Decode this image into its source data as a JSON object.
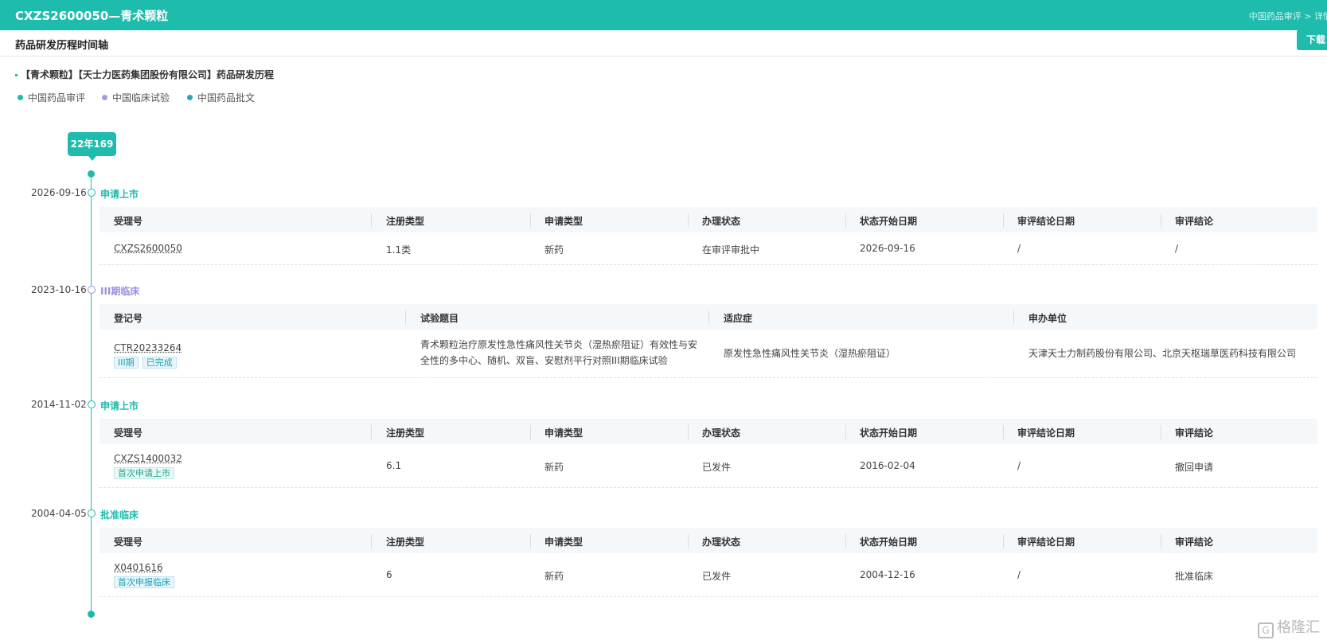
{
  "header": {
    "title": "CXZS2600050—青术颗粒",
    "breadcrumb": "中国药品审评 > 详情"
  },
  "subheader": {
    "title": "药品研发历程时间轴",
    "download_label": "下载"
  },
  "section": {
    "title": "【青术颗粒】【天士力医药集团股份有限公司】药品研发历程"
  },
  "legend": [
    {
      "label": "中国药品审评",
      "color": "#1dbcad"
    },
    {
      "label": "中国临床试验",
      "color": "#a59ae0"
    },
    {
      "label": "中国药品批文",
      "color": "#2aa3c4"
    }
  ],
  "timeline": {
    "duration": "22年169天"
  },
  "colors": {
    "accent": "#1dbcad",
    "clinical": "#9b8ee0"
  },
  "events": [
    {
      "date": "2026-09-16",
      "stage": "申请上市",
      "headers": [
        "受理号",
        "注册类型",
        "申请类型",
        "办理状态",
        "状态开始日期",
        "审评结论日期",
        "审评结论"
      ],
      "row": {
        "id": "CXZS2600050",
        "tags": [],
        "reg_type": "1.1类",
        "app_type": "新药",
        "status": "在审评审批中",
        "status_date": "2026-09-16",
        "conclusion_date": "/",
        "conclusion": "/"
      }
    },
    {
      "date": "2023-10-16",
      "stage": "III期临床",
      "headers": [
        "登记号",
        "试验题目",
        "适应症",
        "申办单位"
      ],
      "row": {
        "id": "CTR20233264",
        "tags": [
          "III期",
          "已完成"
        ],
        "title": "青术颗粒治疗原发性急性痛风性关节炎（湿热瘀阻证）有效性与安全性的多中心、随机、双盲、安慰剂平行对照III期临床试验",
        "indication": "原发性急性痛风性关节炎（湿热瘀阻证）",
        "sponsor": "天津天士力制药股份有限公司、北京天枢瑞草医药科技有限公司"
      }
    },
    {
      "date": "2014-11-02",
      "stage": "申请上市",
      "headers": [
        "受理号",
        "注册类型",
        "申请类型",
        "办理状态",
        "状态开始日期",
        "审评结论日期",
        "审评结论"
      ],
      "row": {
        "id": "CXZS1400032",
        "tags": [
          "首次申请上市"
        ],
        "reg_type": "6.1",
        "app_type": "新药",
        "status": "已发件",
        "status_date": "2016-02-04",
        "conclusion_date": "/",
        "conclusion": "撤回申请"
      }
    },
    {
      "date": "2004-04-05",
      "stage": "批准临床",
      "headers": [
        "受理号",
        "注册类型",
        "申请类型",
        "办理状态",
        "状态开始日期",
        "审评结论日期",
        "审评结论"
      ],
      "row": {
        "id": "X0401616",
        "tags": [
          "首次申报临床"
        ],
        "reg_type": "6",
        "app_type": "新药",
        "status": "已发件",
        "status_date": "2004-12-16",
        "conclusion_date": "/",
        "conclusion": "批准临床"
      }
    }
  ],
  "watermark": {
    "icon": "G",
    "text": "格隆汇"
  }
}
